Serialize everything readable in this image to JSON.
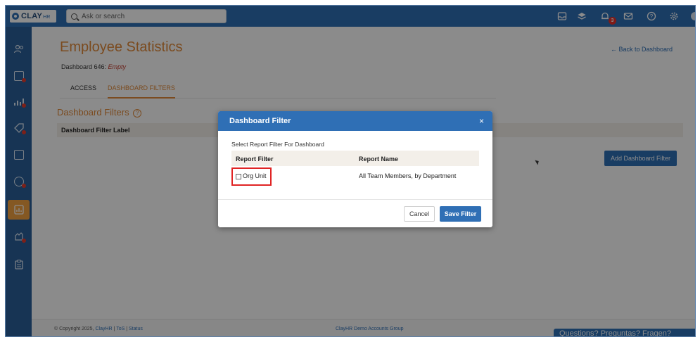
{
  "app": {
    "logo_text": "CLAY",
    "logo_sub": "HR"
  },
  "topbar": {
    "search_placeholder": "Ask or search",
    "notification_count": "3",
    "icons": [
      "inbox-icon",
      "layers-icon",
      "bell-icon",
      "mail-icon",
      "help-icon",
      "settings-icon"
    ]
  },
  "sidebar": {
    "items": [
      {
        "icon": "people-icon"
      },
      {
        "icon": "document-icon",
        "badge": true
      },
      {
        "icon": "chart-icon",
        "badge": true
      },
      {
        "icon": "tag-icon",
        "badge": true
      },
      {
        "icon": "file-icon"
      },
      {
        "icon": "user-circle-icon",
        "badge": true
      },
      {
        "icon": "dashboard-icon",
        "active": true
      },
      {
        "icon": "hand-icon",
        "badge": true
      },
      {
        "icon": "clipboard-icon"
      }
    ]
  },
  "page": {
    "title": "Employee Statistics",
    "back_link": "← Back to Dashboard",
    "dashboard_prefix": "Dashboard 646: ",
    "dashboard_status": "Empty",
    "tabs": [
      {
        "label": "ACCESS",
        "active": false
      },
      {
        "label": "DASHBOARD FILTERS",
        "active": true
      }
    ],
    "section_title": "Dashboard Filters",
    "filter_label_header": "Dashboard Filter Label",
    "add_button": "Add Dashboard Filter"
  },
  "footer": {
    "copyright": "© Copyright 2025,",
    "clayhr_link": "ClayHR",
    "sep1": "|",
    "tos": "ToS",
    "sep2": "|",
    "status": "Status",
    "group": "ClayHR Demo Accounts Group",
    "questions": "Questions? Preguntas? Fragen?"
  },
  "modal": {
    "title": "Dashboard Filter",
    "close": "×",
    "subtitle": "Select Report Filter For Dashboard",
    "columns": [
      "Report Filter",
      "Report Name"
    ],
    "row": {
      "filter": "Org Unit",
      "name": "All Team Members, by Department",
      "checked": false
    },
    "cancel_label": "Cancel",
    "save_label": "Save Filter"
  },
  "colors": {
    "primary": "#2f6fb5",
    "accent": "#e0893a",
    "highlight": "#e02424"
  }
}
